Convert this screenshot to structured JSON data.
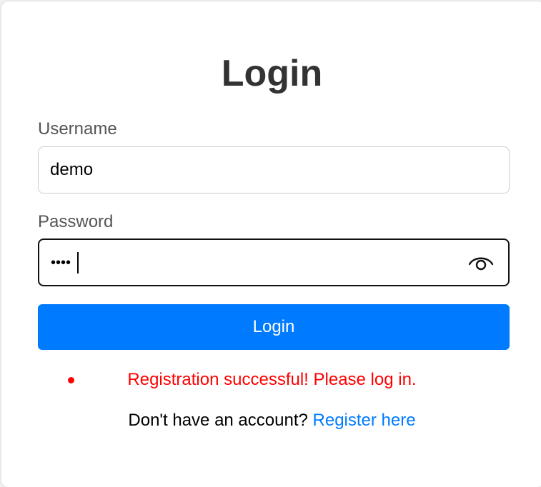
{
  "title": "Login",
  "username": {
    "label": "Username",
    "value": "demo"
  },
  "password": {
    "label": "Password",
    "masked_value": "••••",
    "toggle_icon": "eye-icon"
  },
  "login_button": {
    "label": "Login"
  },
  "messages": [
    "Registration successful! Please log in."
  ],
  "footer": {
    "text": "Don't have an account?",
    "link_label": "Register here"
  },
  "colors": {
    "accent": "#007bff",
    "error": "#ff0000",
    "title": "#333333"
  }
}
